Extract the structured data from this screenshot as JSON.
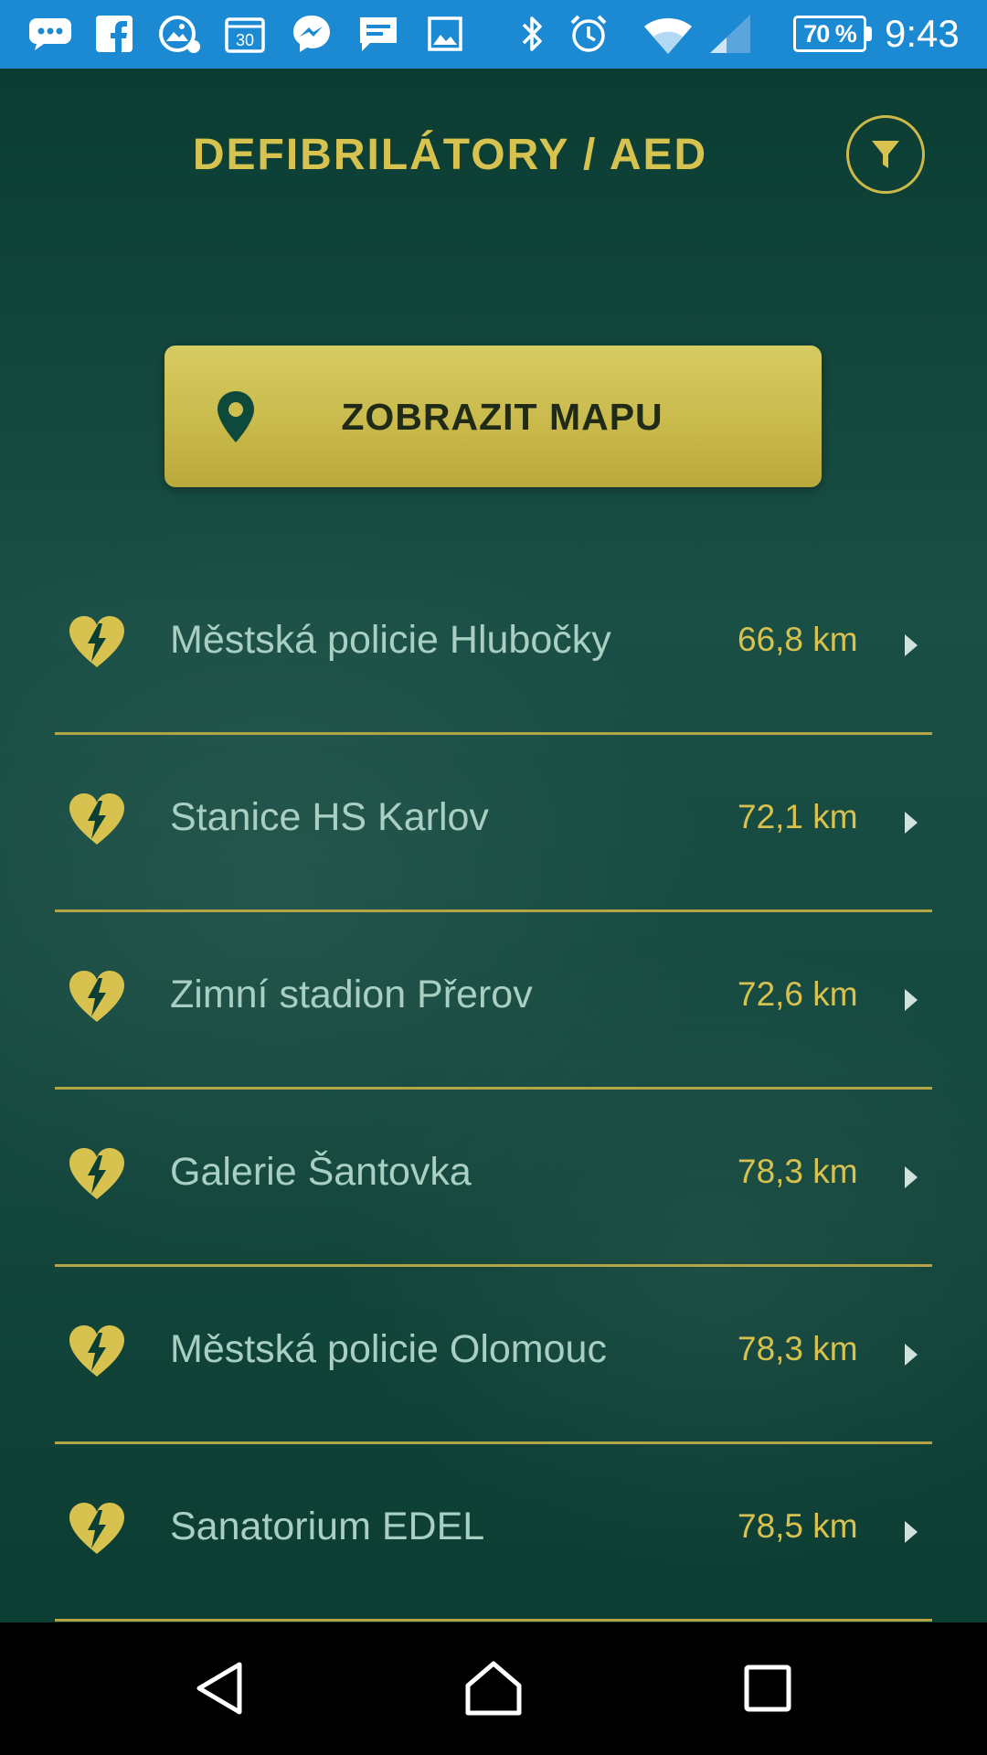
{
  "status_bar": {
    "left_icons": [
      "chat-bubble-icon",
      "facebook-icon",
      "gallery-icon",
      "calendar-icon",
      "messenger-icon",
      "message-icon",
      "image-icon"
    ],
    "battery_percent": "70 %",
    "time": "9:43"
  },
  "header": {
    "title": "DEFIBRILÁTORY / AED",
    "filter_icon": "funnel-icon"
  },
  "map_button": {
    "label": "ZOBRAZIT MAPU",
    "icon": "map-pin-icon"
  },
  "list": {
    "items": [
      {
        "name": "Městská policie Hlubočky",
        "distance": "66,8 km"
      },
      {
        "name": "Stanice HS Karlov",
        "distance": "72,1 km"
      },
      {
        "name": "Zimní stadion Přerov",
        "distance": "72,6 km"
      },
      {
        "name": "Galerie Šantovka",
        "distance": "78,3 km"
      },
      {
        "name": "Městská policie Olomouc",
        "distance": "78,3 km"
      },
      {
        "name": "Sanatorium EDEL",
        "distance": "78,5 km"
      }
    ]
  },
  "colors": {
    "status_bar": "#1c8ad3",
    "background": "#0c3f34",
    "accent_gold": "#d7c24f",
    "item_text": "#a8cfc2"
  }
}
